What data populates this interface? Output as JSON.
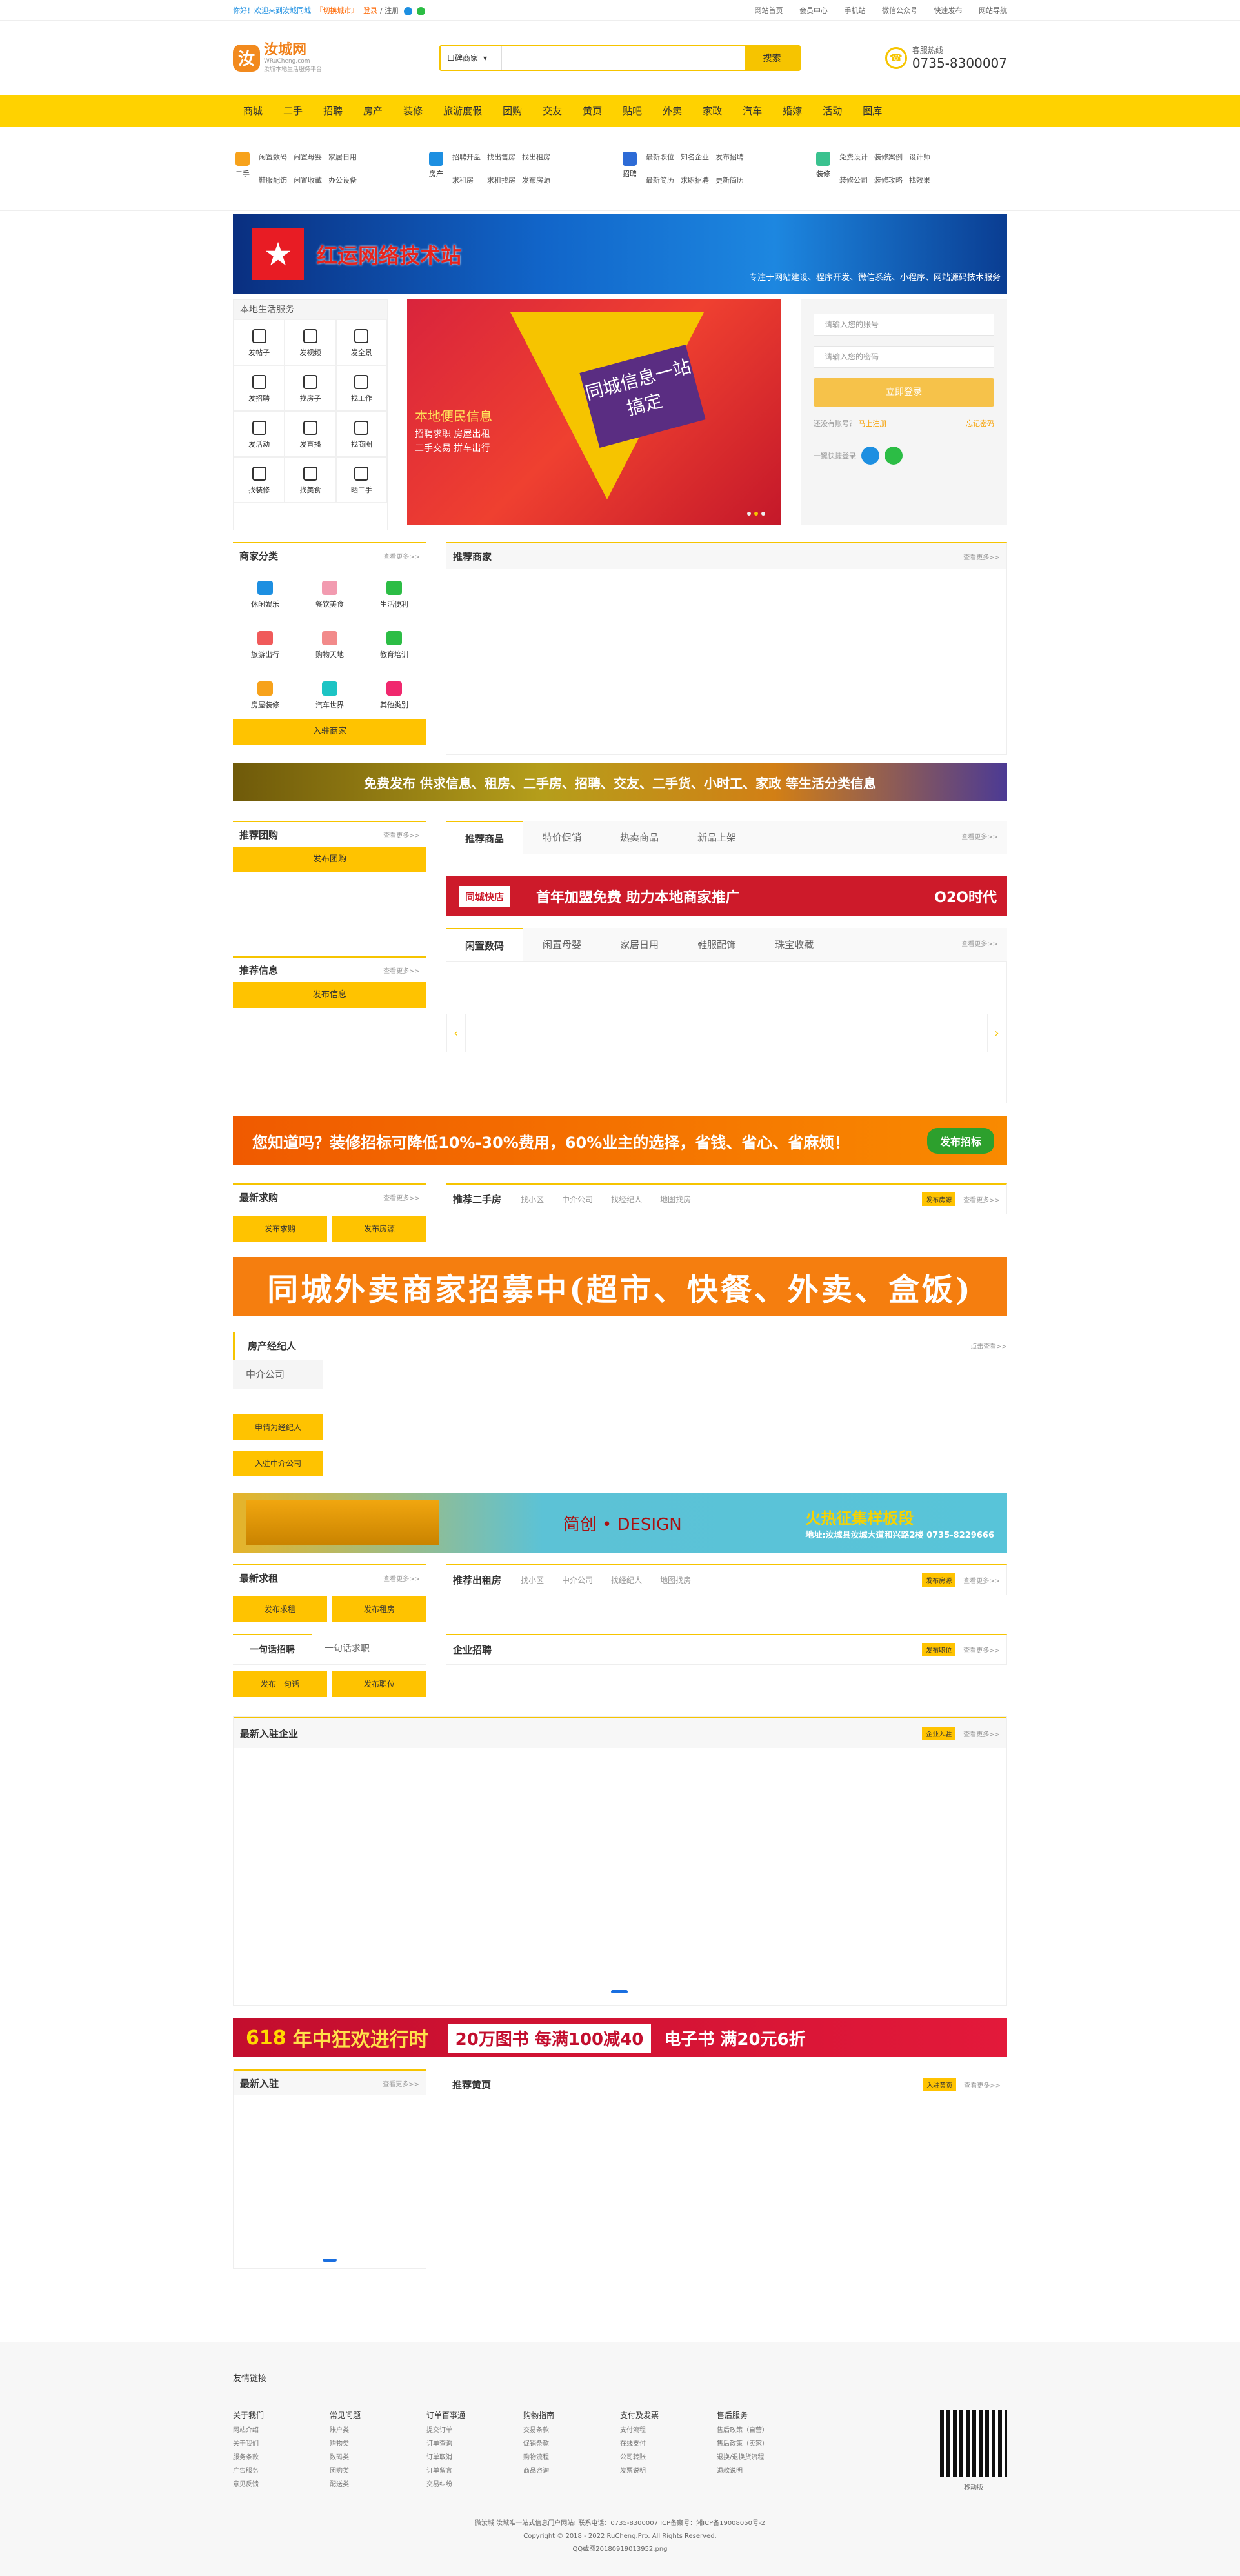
{
  "topbar": {
    "left": "你好！欢迎来到汝城同城",
    "link_city": "『切换城市』",
    "login": "登录",
    "sep": "/",
    "register": "注册",
    "right": [
      "网站首页",
      "会员中心",
      "手机站",
      "微信公众号",
      "快速发布",
      "网站导航"
    ]
  },
  "header": {
    "logo_text": "汝城网",
    "logo_sub": "WRuCheng.com",
    "logo_tag": "汝城本地生活服务平台",
    "search_cat": "口碑商家",
    "search_placeholder": "",
    "search_btn": "搜索",
    "hotline_label": "客服热线",
    "hotline_num": "0735-8300007"
  },
  "nav": [
    "商城",
    "二手",
    "招聘",
    "房产",
    "装修",
    "旅游度假",
    "团购",
    "交友",
    "黄页",
    "贴吧",
    "外卖",
    "家政",
    "汽车",
    "婚嫁",
    "活动",
    "图库"
  ],
  "quick": [
    {
      "icon": "二手",
      "links": [
        "闲置数码",
        "闲置母婴",
        "家居日用",
        "鞋服配饰",
        "闲置收藏",
        "办公设备"
      ]
    },
    {
      "icon": "房产",
      "links": [
        "招聘开盘",
        "找出售房",
        "找出租房",
        "求租房",
        "求租找房",
        "发布房源"
      ]
    },
    {
      "icon": "招聘",
      "links": [
        "最新职位",
        "知名企业",
        "发布招聘",
        "最新简历",
        "求职招聘",
        "更新简历"
      ]
    },
    {
      "icon": "装修",
      "links": [
        "免费设计",
        "装修案例",
        "设计师",
        "装修公司",
        "装修攻略",
        "找效果"
      ]
    }
  ],
  "banner": {
    "title": "红运网络技术站",
    "sub": "专注于网站建设、程序开发、微信系统、小程序、网站源码技术服务"
  },
  "life": {
    "title": "本地生活服务",
    "items": [
      "发帖子",
      "发视频",
      "发全景",
      "发招聘",
      "找房子",
      "找工作",
      "发活动",
      "发直播",
      "找商圈",
      "找装修",
      "找美食",
      "晒二手"
    ]
  },
  "slide": {
    "plate": "同城信息一站搞定",
    "title": "本地便民信息",
    "lines": [
      "招聘求职  房屋出租",
      "二手交易  拼车出行"
    ]
  },
  "login": {
    "user_ph": "请输入您的账号",
    "pass_ph": "请输入您的密码",
    "btn": "立即登录",
    "noacc": "还没有账号？",
    "reg": "马上注册",
    "forgot": "忘记密码",
    "quick": "一键快捷登录"
  },
  "biz": {
    "title": "商家分类",
    "more": "查看更多>>",
    "items": [
      "休闲娱乐",
      "餐饮美食",
      "生活便利",
      "旅游出行",
      "购物天地",
      "教育培训",
      "房屋装修",
      "汽车世界",
      "其他类别"
    ],
    "btn": "入驻商家"
  },
  "rec_biz": {
    "title": "推荐商家",
    "more": "查看更多>>"
  },
  "ad1": "免费发布 供求信息、租房、二手房、招聘、交友、二手货、小时工、家政 等生活分类信息",
  "tuan": {
    "title": "推荐团购",
    "more": "查看更多>>",
    "btn": "发布团购"
  },
  "goods_tabs": [
    "推荐商品",
    "特价促销",
    "热卖商品",
    "新品上架"
  ],
  "more": "查看更多>>",
  "kfc": {
    "box": "同城快店",
    "text": "首年加盟免费 助力本地商家推广",
    "o2o": "O2O时代"
  },
  "info": {
    "title": "推荐信息",
    "more": "查看更多>>",
    "btn": "发布信息"
  },
  "idle_tabs": [
    "闲置数码",
    "闲置母婴",
    "家居日用",
    "鞋服配饰",
    "珠宝收藏"
  ],
  "arrows": [
    "‹",
    "›"
  ],
  "ad2": "您知道吗？装修招标可降低10%-30%费用，60%业主的选择，省钱、省心、省麻烦！",
  "ad2_btn": "发布招标",
  "buy": {
    "title": "最新求购",
    "more": "查看更多>>",
    "btns": [
      "发布求购",
      "发布房源"
    ]
  },
  "second": {
    "title": "推荐二手房",
    "tabs": [
      "找小区",
      "中介公司",
      "找经纪人",
      "地图找房"
    ],
    "pub": "发布房源",
    "more": "查看更多>>"
  },
  "ad3": "同城外卖商家招募中(超市、快餐、外卖、盒饭)",
  "agent": {
    "t1": "房产经纪人",
    "t2": "中介公司",
    "more": "点击查看>>",
    "b1": "申请为经纪人",
    "b2": "入驻中介公司"
  },
  "ad4": {
    "brand": "简创 • DESIGN",
    "text": "火热征集样板段",
    "addr": "地址:汝城县汝城大道和兴路2楼",
    "tel": "0735-8229666"
  },
  "rentreq": {
    "title": "最新求租",
    "more": "查看更多>>",
    "btns": [
      "发布求租",
      "发布租房"
    ]
  },
  "rent": {
    "title": "推荐出租房",
    "tabs": [
      "找小区",
      "中介公司",
      "找经纪人",
      "地图找房"
    ],
    "pub": "发布房源",
    "more": "查看更多>>"
  },
  "job": {
    "tabs": [
      "一句话招聘",
      "一句话求职"
    ],
    "btns": [
      "发布一句话",
      "发布职位"
    ]
  },
  "company": {
    "title": "企业招聘",
    "pub": "发布职位",
    "more": "查看更多>>"
  },
  "newent": {
    "title": "最新入驻企业",
    "pub": "企业入驻",
    "more": "查看更多>>"
  },
  "ad5": {
    "a": "618",
    "b": "年中狂欢进行时",
    "c": "20万图书 每满100减40",
    "d": "电子书 满20元6折"
  },
  "newin": {
    "title": "最新入驻",
    "more": "查看更多>>"
  },
  "yellow": {
    "title": "推荐黄页",
    "pub": "入驻黄页",
    "more": "查看更多>>"
  },
  "footer": {
    "friend": "友情链接",
    "cols": [
      {
        "h": "关于我们",
        "i": [
          "网站介绍",
          "关于我们",
          "服务条款",
          "广告服务",
          "意见反馈"
        ]
      },
      {
        "h": "常见问题",
        "i": [
          "账户类",
          "购物类",
          "数码类",
          "团购类",
          "配送类"
        ]
      },
      {
        "h": "订单百事通",
        "i": [
          "提交订单",
          "订单查询",
          "订单取消",
          "订单留言",
          "交易纠纷"
        ]
      },
      {
        "h": "购物指南",
        "i": [
          "交易条款",
          "促销条款",
          "购物流程",
          "商品咨询"
        ]
      },
      {
        "h": "支付及发票",
        "i": [
          "支付流程",
          "在线支付",
          "公司转账",
          "发票说明"
        ]
      },
      {
        "h": "售后服务",
        "i": [
          "售后政策（自营）",
          "售后政策（卖家）",
          "退换/退换货流程",
          "退款说明"
        ]
      }
    ],
    "qr": "移动版",
    "line1": "微汝城 汝城唯一站式信息门户网站! 联系电话：0735-8300007 ICP备案号：湘ICP备19008050号-2",
    "line2": "Copyright © 2018 - 2022 RuCheng.Pro. All Rights Reserved.",
    "line3": "QQ截图20180919013952.png"
  },
  "colors": {
    "accent": "#ffc300",
    "nav": "#ffd200",
    "brand": "#f08019"
  }
}
